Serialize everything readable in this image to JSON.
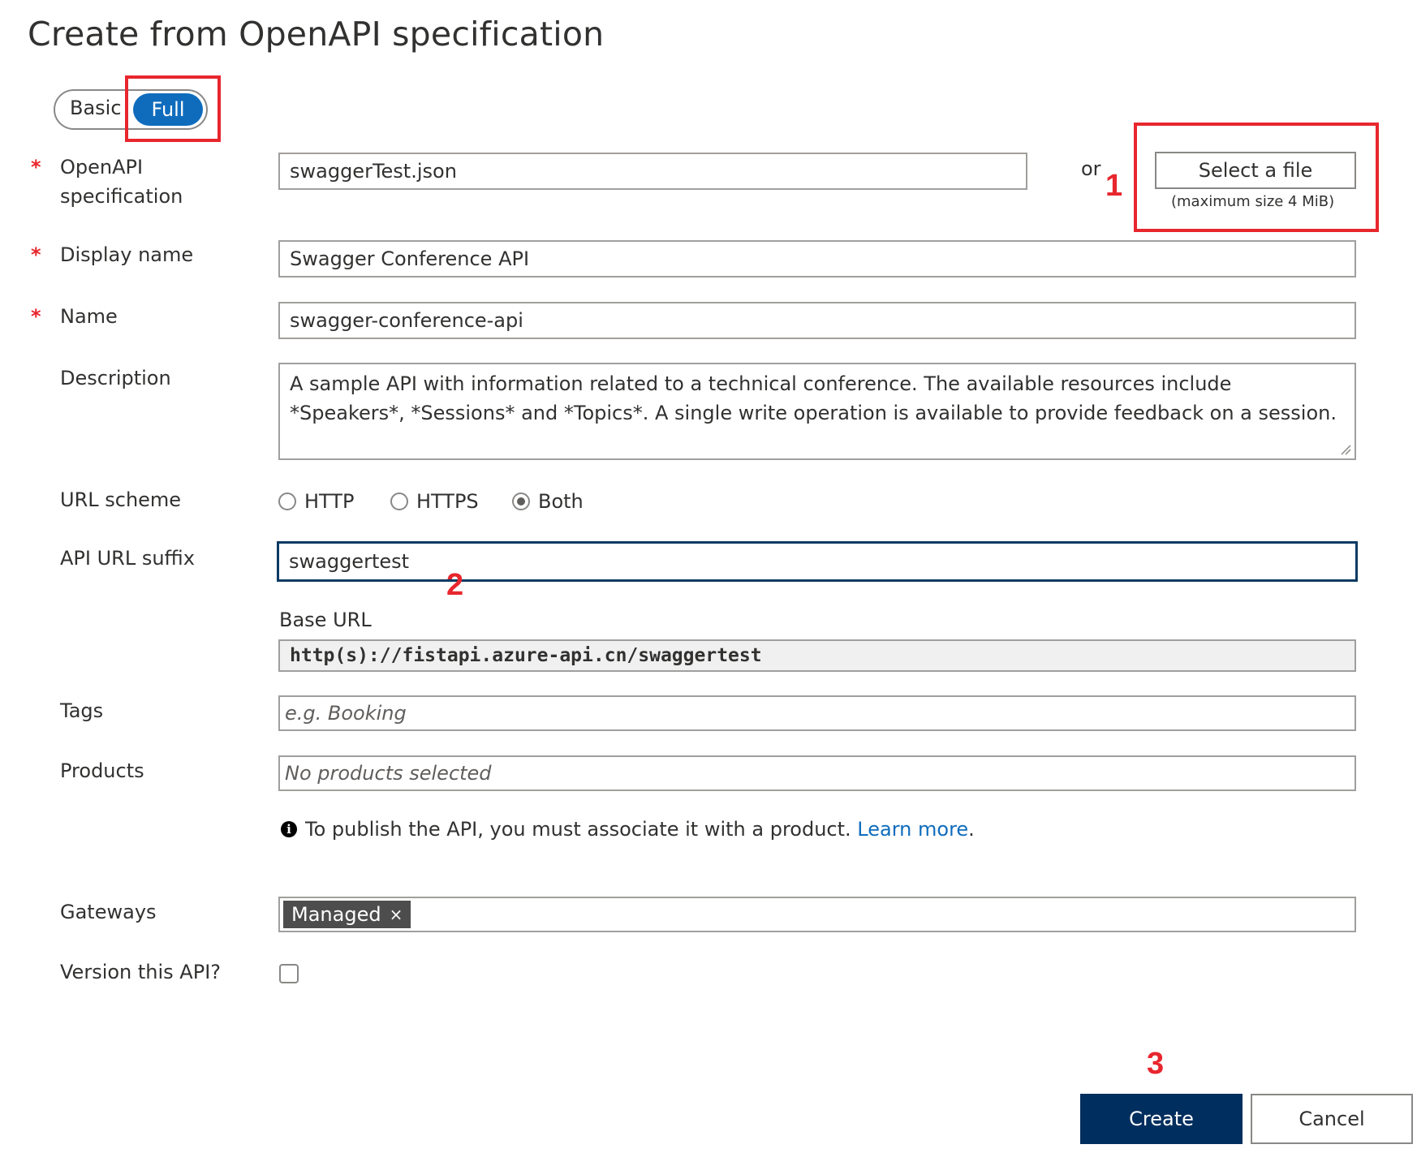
{
  "page": {
    "title": "Create from OpenAPI specification"
  },
  "mode_toggle": {
    "options": [
      "Basic",
      "Full"
    ],
    "selected": "Full"
  },
  "form": {
    "openapi_spec": {
      "label_line1": "OpenAPI",
      "label_line2": "specification",
      "required": "*",
      "value": "swaggerTest.json",
      "or_text": "or",
      "select_file_label": "Select a file",
      "max_size_hint": "(maximum size 4 MiB)"
    },
    "display_name": {
      "label": "Display name",
      "required": "*",
      "value": "Swagger Conference API"
    },
    "name": {
      "label": "Name",
      "required": "*",
      "value": "swagger-conference-api"
    },
    "description": {
      "label": "Description",
      "value": "A sample API with information related to a technical conference.  The available resources  include *Speakers*, *Sessions* and *Topics*.  A single write operation is available to provide  feedback on a session."
    },
    "url_scheme": {
      "label": "URL scheme",
      "options": [
        "HTTP",
        "HTTPS",
        "Both"
      ],
      "selected": "Both"
    },
    "api_url_suffix": {
      "label": "API URL suffix",
      "value": "swaggertest"
    },
    "base_url": {
      "label": "Base URL",
      "value": "http(s)://fistapi.azure-api.cn/swaggertest"
    },
    "tags": {
      "label": "Tags",
      "placeholder": "e.g. Booking"
    },
    "products": {
      "label": "Products",
      "placeholder": "No products selected",
      "info_text": "To publish the API, you must associate it with a product.",
      "learn_more": "Learn more",
      "info_suffix": "."
    },
    "gateways": {
      "label": "Gateways",
      "chips": [
        {
          "label": "Managed",
          "remove": "×"
        }
      ]
    },
    "version": {
      "label": "Version this API?",
      "checked": false
    }
  },
  "actions": {
    "create_label": "Create",
    "cancel_label": "Cancel"
  },
  "annotations": {
    "step1": "1",
    "step2": "2",
    "step3": "3",
    "color": "#e8262d"
  },
  "colors": {
    "accent": "#0f6cbd",
    "primary_button": "#002e5e",
    "required": "#e8262d",
    "chip": "#4d4d4d"
  }
}
